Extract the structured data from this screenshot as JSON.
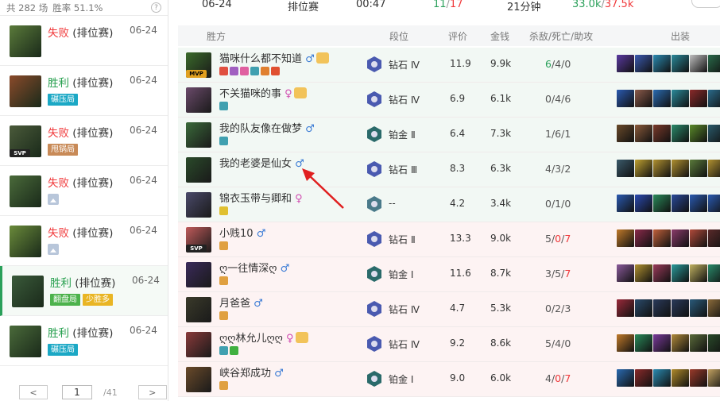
{
  "left": {
    "summary": {
      "total_label": "共 282 场",
      "winrate_label": "胜率 51.1%",
      "help": "?"
    },
    "matches": [
      {
        "result": "失败",
        "mode": "(排位赛)",
        "date": "06-24",
        "outcome": "l",
        "tags": [],
        "img": false,
        "svp": false,
        "avatar_color": "#5a7a3a"
      },
      {
        "result": "胜利",
        "mode": "(排位赛)",
        "date": "06-24",
        "outcome": "w",
        "tags": [
          {
            "label": "碾压局",
            "cls": "t-teal"
          }
        ],
        "img": false,
        "svp": false,
        "avatar_color": "#8a4a2a"
      },
      {
        "result": "失败",
        "mode": "(排位赛)",
        "date": "06-24",
        "outcome": "l",
        "tags": [
          {
            "label": "甩锅局",
            "cls": "t-brown"
          }
        ],
        "img": false,
        "svp": true,
        "avatar_color": "#4a5a3a"
      },
      {
        "result": "失败",
        "mode": "(排位赛)",
        "date": "06-24",
        "outcome": "l",
        "tags": [],
        "img": true,
        "svp": false,
        "avatar_color": "#4a6a3a"
      },
      {
        "result": "失败",
        "mode": "(排位赛)",
        "date": "06-24",
        "outcome": "l",
        "tags": [],
        "img": true,
        "svp": false,
        "avatar_color": "#6a8a3a"
      },
      {
        "result": "胜利",
        "mode": "(排位赛)",
        "date": "06-24",
        "outcome": "w",
        "tags": [
          {
            "label": "翻盘局",
            "cls": "t-green"
          },
          {
            "label": "少胜多",
            "cls": "t-yellow"
          }
        ],
        "img": false,
        "svp": false,
        "avatar_color": "#3a5a3a",
        "selected": true
      },
      {
        "result": "胜利",
        "mode": "(排位赛)",
        "date": "06-24",
        "outcome": "w",
        "tags": [
          {
            "label": "碾压局",
            "cls": "t-teal"
          }
        ],
        "img": false,
        "svp": false,
        "avatar_color": "#4a6a3a"
      }
    ],
    "pager": {
      "prev": "<",
      "page": "1",
      "total": "/41",
      "next": ">"
    }
  },
  "summary_row": {
    "date": "06-24",
    "mode": "排位赛",
    "duration": "00:47",
    "kills": "11",
    "kills_sep": "/",
    "deaths": "17",
    "time": "21分钟",
    "gold_a": "33.0k",
    "gold_sep": "/",
    "gold_b": "37.5k"
  },
  "table": {
    "headers": {
      "team": "胜方",
      "rank": "段位",
      "score": "评价",
      "gold": "金钱",
      "kda": "杀敌/死亡/助攻",
      "items": "出装"
    },
    "rows": [
      {
        "name": "猫咪什么都不知道",
        "gender": "m",
        "trophy": true,
        "mvp": "MVP",
        "svp": "",
        "rank": "钻石 Ⅳ",
        "score": "11.9",
        "score_red": false,
        "gold": "9.9k",
        "gold_green": true,
        "k": "6",
        "d": "4",
        "a": "0",
        "k_green": true,
        "d_red": false,
        "a_red": false,
        "type": "win",
        "avatar_color": "#3a6a2a",
        "rank_color": "#4a5ab0",
        "badge_colors": [
          "#e05040",
          "#a060c0",
          "#e060a0",
          "#40a0b0",
          "#e08030",
          "#e05030"
        ],
        "item_colors": [
          "#5a3aa0",
          "#3a5ab0",
          "#2a8ab0",
          "#2a8a9a",
          "#c0c0c0",
          "#2a6a4a"
        ]
      },
      {
        "name": "不关猫咪的事",
        "gender": "f",
        "trophy": true,
        "mvp": "",
        "svp": "",
        "rank": "钻石 Ⅳ",
        "score": "6.9",
        "score_red": false,
        "gold": "6.1k",
        "gold_green": false,
        "k": "0",
        "d": "4",
        "a": "6",
        "k_green": false,
        "d_red": false,
        "a_red": false,
        "type": "win",
        "avatar_color": "#6a4a6a",
        "rank_color": "#4a5ab0",
        "badge_colors": [
          "#40a0b0"
        ],
        "item_colors": [
          "#2a5ab0",
          "#8a5a4a",
          "#2a6ab0",
          "#2a8a9a",
          "#8a2a2a",
          "#2a6a8a"
        ]
      },
      {
        "name": "我的队友像在做梦",
        "gender": "m",
        "trophy": false,
        "mvp": "",
        "svp": "",
        "rank": "铂金 Ⅱ",
        "score": "6.4",
        "score_red": false,
        "gold": "7.3k",
        "gold_green": false,
        "k": "1",
        "d": "6",
        "a": "1",
        "k_green": false,
        "d_red": false,
        "a_red": false,
        "type": "win",
        "avatar_color": "#3a6a3a",
        "rank_color": "#2a6a6a",
        "badge_colors": [
          "#40a0b0"
        ],
        "item_colors": [
          "#6a4a2a",
          "#8a5a3a",
          "#7a3a2a",
          "#2a8a6a",
          "#5a8a2a",
          "#2a5a6a"
        ]
      },
      {
        "name": "我的老婆是仙女",
        "gender": "m",
        "trophy": false,
        "mvp": "",
        "svp": "",
        "rank": "钻石 Ⅲ",
        "score": "8.3",
        "score_red": false,
        "gold": "6.3k",
        "gold_green": false,
        "k": "4",
        "d": "3",
        "a": "2",
        "k_green": false,
        "d_red": false,
        "a_red": false,
        "type": "win",
        "avatar_color": "#2a4a2a",
        "rank_color": "#4a5ab0",
        "badge_colors": [],
        "item_colors": [
          "#3a5a6a",
          "#c0a030",
          "#b09030",
          "#b09030",
          "#5a7a3a",
          "#b09030"
        ]
      },
      {
        "name": "锦衣玉带与卿和",
        "gender": "f",
        "trophy": false,
        "mvp": "",
        "svp": "",
        "rank": "--",
        "score": "4.2",
        "score_red": false,
        "gold": "3.4k",
        "gold_green": false,
        "k": "0",
        "d": "1",
        "a": "0",
        "k_green": false,
        "d_red": false,
        "a_red": false,
        "type": "win",
        "avatar_color": "#4a4a6a",
        "rank_color": "#4a7a8a",
        "badge_colors": [
          "#e0c030"
        ],
        "item_colors": [
          "#2a5ab0",
          "#2a4ab0",
          "#2a8a5a",
          "#2a4a9a",
          "#2a5ab0",
          "#2a5ab0"
        ]
      },
      {
        "name": "小贱10",
        "gender": "m",
        "trophy": false,
        "mvp": "",
        "svp": "SVP",
        "rank": "钻石 Ⅱ",
        "score": "13.3",
        "score_red": true,
        "gold": "9.0k",
        "gold_green": false,
        "k": "5",
        "d": "0",
        "a": "7",
        "k_green": false,
        "d_red": true,
        "a_red": true,
        "type": "loss",
        "avatar_color": "#c05a5a",
        "rank_color": "#4a5ab0",
        "badge_colors": [
          "#e0a040"
        ],
        "item_colors": [
          "#c07a2a",
          "#8a2a4a",
          "#c0603a",
          "#8a3a6a",
          "#b04a3a",
          "#5a2a2a"
        ]
      },
      {
        "name": "ღ一往情深ღ",
        "gender": "m",
        "trophy": false,
        "mvp": "",
        "svp": "",
        "rank": "铂金 Ⅰ",
        "score": "11.6",
        "score_red": false,
        "gold": "8.7k",
        "gold_green": false,
        "k": "3",
        "d": "5",
        "a": "7",
        "k_green": false,
        "d_red": false,
        "a_red": true,
        "type": "loss",
        "avatar_color": "#3a2a5a",
        "rank_color": "#2a6a6a",
        "badge_colors": [
          "#e0a040"
        ],
        "item_colors": [
          "#8a5a9a",
          "#b09030",
          "#9a3a5a",
          "#2a9a9a",
          "#c0b060",
          "#2a8a6a"
        ]
      },
      {
        "name": "月爸爸",
        "gender": "m",
        "trophy": false,
        "mvp": "",
        "svp": "",
        "rank": "钻石 Ⅳ",
        "score": "4.7",
        "score_red": false,
        "gold": "5.3k",
        "gold_green": false,
        "k": "0",
        "d": "2",
        "a": "3",
        "k_green": false,
        "d_red": false,
        "a_red": false,
        "type": "loss",
        "avatar_color": "#3a3a2a",
        "rank_color": "#4a5ab0",
        "badge_colors": [
          "#e0a040"
        ],
        "item_colors": [
          "#9a2a3a",
          "#2a4a6a",
          "#2a3a5a",
          "#2a3a5a",
          "#2a5a7a",
          "#8a6a3a"
        ]
      },
      {
        "name": "ღღ林允儿ღღ",
        "gender": "f",
        "trophy": true,
        "mvp": "",
        "svp": "",
        "rank": "钻石 Ⅳ",
        "score": "9.2",
        "score_red": false,
        "gold": "8.6k",
        "gold_green": false,
        "k": "5",
        "d": "4",
        "a": "0",
        "k_green": false,
        "d_red": false,
        "a_red": false,
        "type": "loss",
        "avatar_color": "#8a3a3a",
        "rank_color": "#4a5ab0",
        "badge_colors": [
          "#40a0b0",
          "#40b040"
        ],
        "item_colors": [
          "#c07a2a",
          "#2a8a5a",
          "#7a3a9a",
          "#b08a3a",
          "#5a6a3a",
          "#2a4a2a"
        ]
      },
      {
        "name": "峡谷郑成功",
        "gender": "m",
        "trophy": false,
        "mvp": "",
        "svp": "",
        "rank": "铂金 Ⅰ",
        "score": "9.0",
        "score_red": false,
        "gold": "6.0k",
        "gold_green": false,
        "k": "4",
        "d": "0",
        "a": "7",
        "k_green": false,
        "d_red": true,
        "a_red": true,
        "type": "loss",
        "avatar_color": "#6a4a2a",
        "rank_color": "#2a6a6a",
        "badge_colors": [
          "#e0a040"
        ],
        "item_colors": [
          "#2a6ab0",
          "#8a2a2a",
          "#2a8ab0",
          "#b08a2a",
          "#9a3a2a",
          "#c0a060"
        ]
      }
    ]
  },
  "gender_symbols": {
    "m": "♂",
    "f": "♀"
  },
  "colors": {
    "win_green": "#27a04f",
    "loss_red": "#f0383a",
    "male_blue": "#3a7bd5",
    "female_pink": "#d04bb0",
    "arrow_red": "#e02020"
  }
}
